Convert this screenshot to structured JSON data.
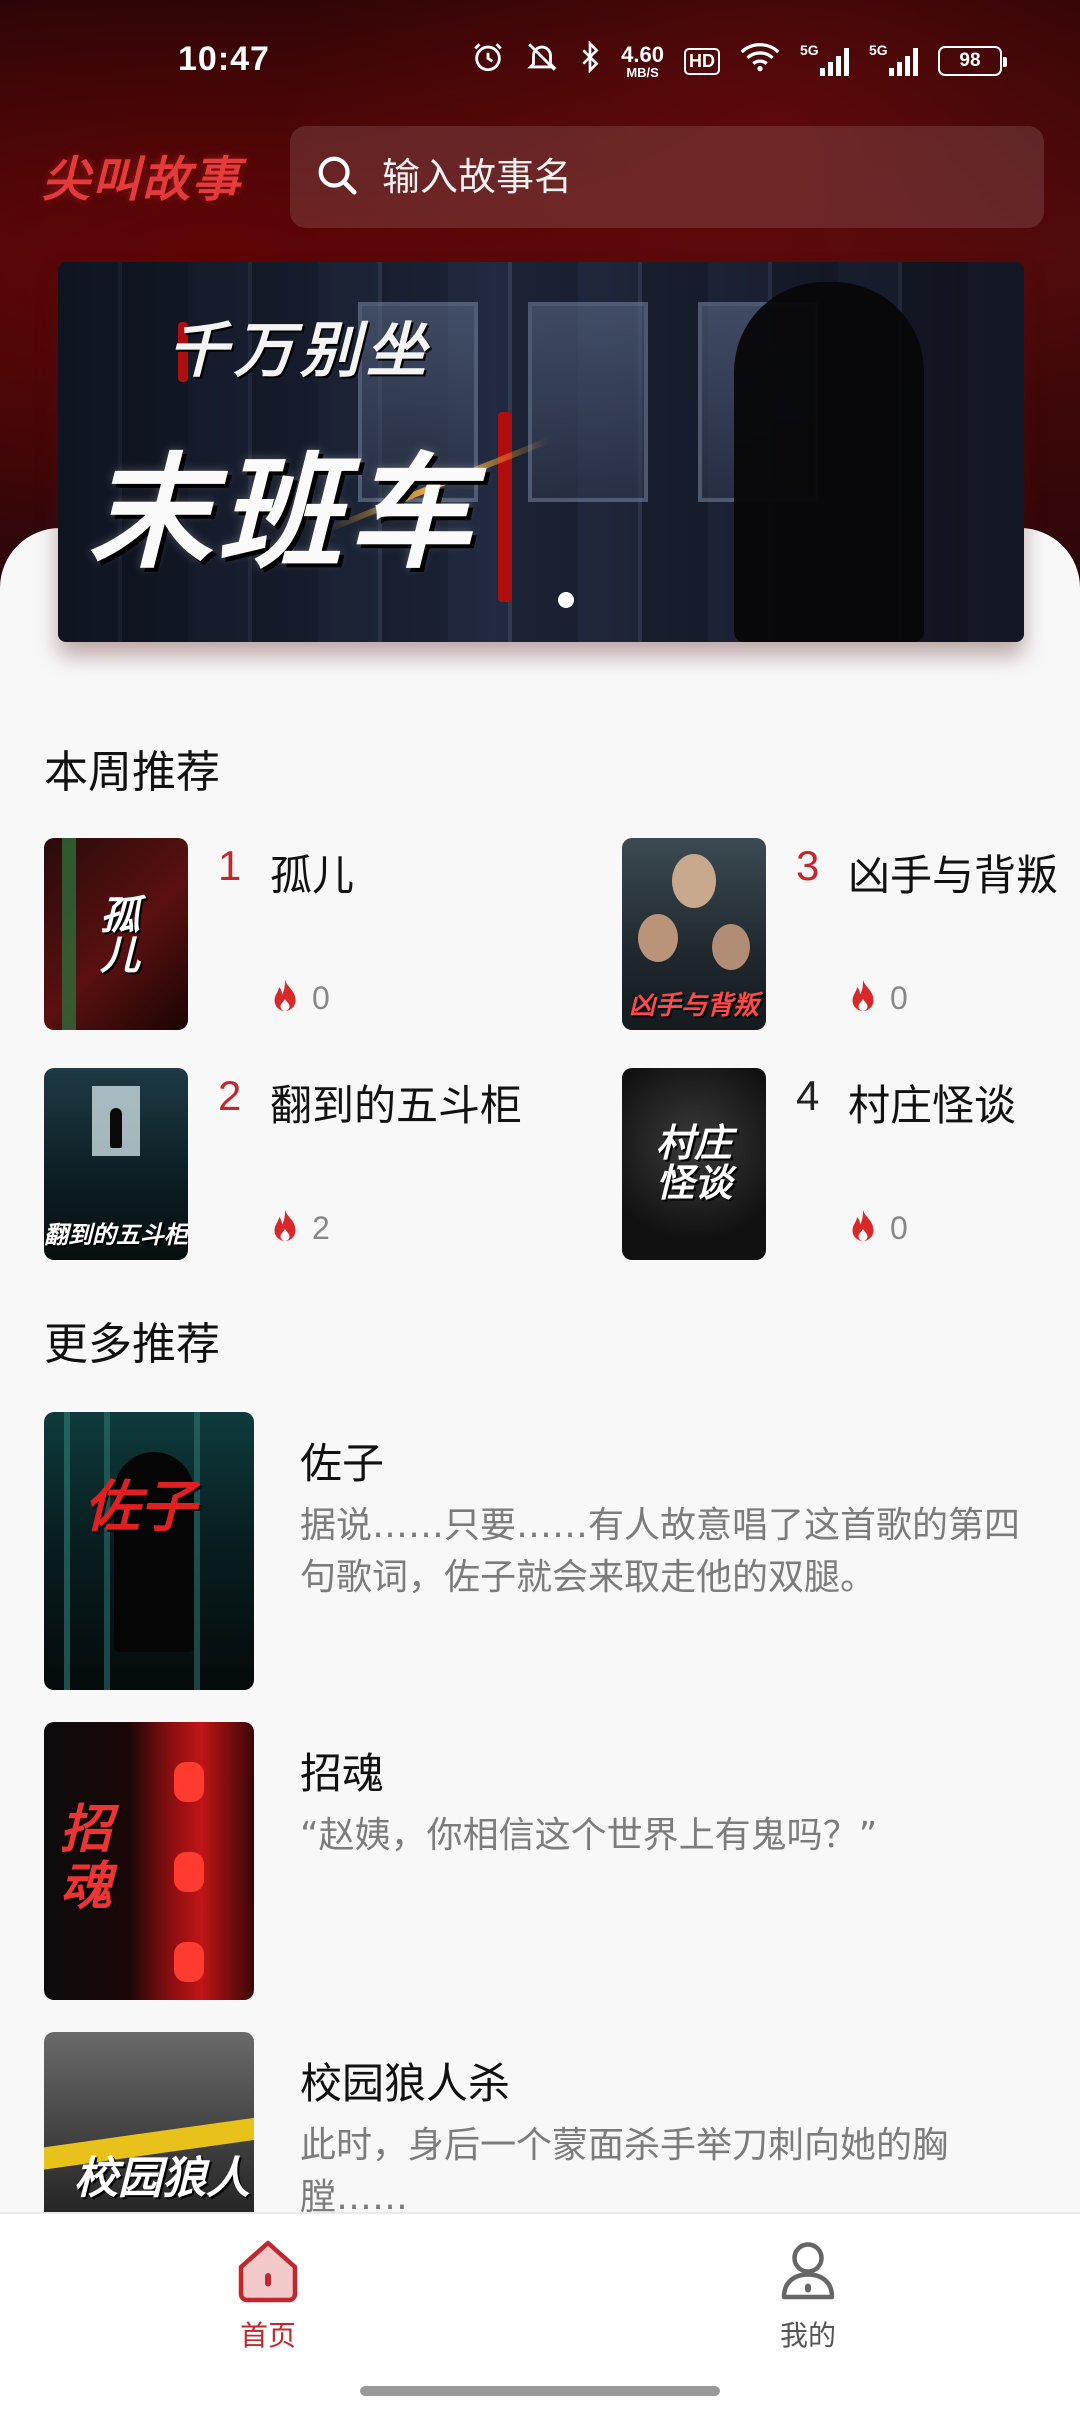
{
  "status_bar": {
    "time": "10:47",
    "net_speed_value": "4.60",
    "net_speed_unit": "MB/S",
    "hd_label": "HD",
    "signal1_label": "5G",
    "signal2_label": "5G",
    "battery": "98",
    "icons": [
      "alarm-icon",
      "mute-icon",
      "bluetooth-icon",
      "wifi-icon"
    ]
  },
  "header": {
    "logo": "尖叫故事",
    "search_placeholder": "输入故事名"
  },
  "banner": {
    "subtitle": "千万别坐",
    "title": "末班车"
  },
  "weekly": {
    "title": "本周推荐",
    "items": [
      {
        "rank": "1",
        "title": "孤儿",
        "heat": "0",
        "cover_text": "孤儿"
      },
      {
        "rank": "3",
        "title": "凶手与背叛",
        "heat": "0",
        "cover_text": "凶手与背叛"
      },
      {
        "rank": "2",
        "title": "翻到的五斗柜",
        "heat": "2",
        "cover_text": "翻到的五斗柜"
      },
      {
        "rank": "4",
        "title": "村庄怪谈",
        "heat": "0",
        "cover_text": "村庄怪谈"
      }
    ]
  },
  "more": {
    "title": "更多推荐",
    "items": [
      {
        "title": "佐子",
        "desc": "据说……只要……有人故意唱了这首歌的第四句歌词，佐子就会来取走他的双腿。",
        "cover_text": "佐子"
      },
      {
        "title": "招魂",
        "desc": "“赵姨，你相信这个世界上有鬼吗？”",
        "cover_text": "招魂"
      },
      {
        "title": "校园狼人杀",
        "desc": "此时，身后一个蒙面杀手举刀刺向她的胸膛……",
        "cover_text": "校园狼人杀"
      }
    ]
  },
  "nav": {
    "home": "首页",
    "mine": "我的"
  },
  "colors": {
    "accent": "#c0282e",
    "rank_red": "#c0282e",
    "rank_default": "#222222",
    "text_muted": "#7c7c7c"
  }
}
